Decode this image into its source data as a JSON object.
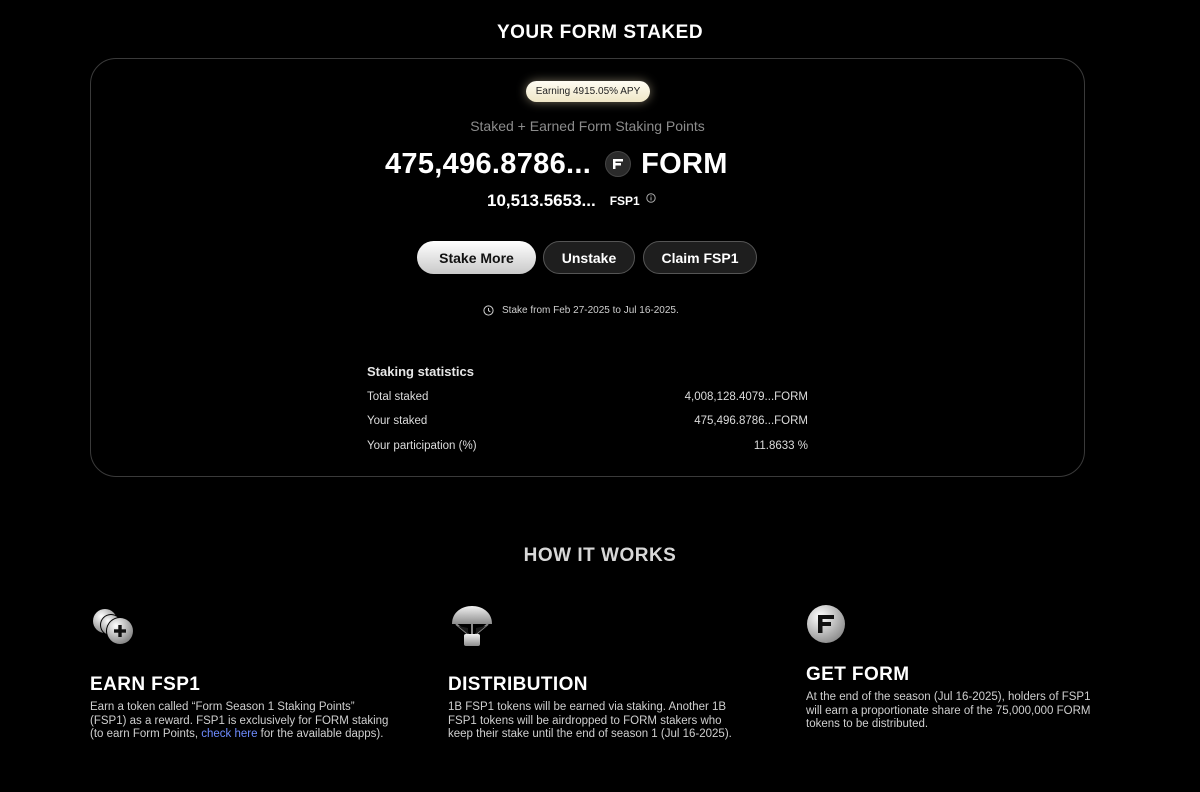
{
  "staked_section": {
    "title": "YOUR FORM STAKED",
    "apy_badge": "Earning 4915.05% APY",
    "subtitle": "Staked + Earned Form Staking Points",
    "form_amount": "475,496.8786...",
    "form_token": "FORM",
    "fsp_amount": "10,513.5653...",
    "fsp_token": "FSP1",
    "buttons": {
      "stake_more": "Stake More",
      "unstake": "Unstake",
      "claim": "Claim FSP1"
    },
    "period": "Stake from Feb 27-2025 to Jul 16-2025."
  },
  "statistics": {
    "title": "Staking statistics",
    "rows": [
      {
        "label": "Total staked",
        "value": "4,008,128.4079...FORM"
      },
      {
        "label": "Your staked",
        "value": "475,496.8786...FORM"
      },
      {
        "label": "Your participation (%)",
        "value": "11.8633 %"
      }
    ]
  },
  "how_it_works": {
    "title": "HOW IT WORKS",
    "items": [
      {
        "icon": "coins-plus-icon",
        "heading": "EARN FSP1",
        "text_before_link": "Earn a token called “Form Season 1 Staking Points” (FSP1) as a reward. FSP1 is exclusively for FORM staking (to earn Form Points, ",
        "link": "check here",
        "text_after_link": " for the available dapps)."
      },
      {
        "icon": "parachute-icon",
        "heading": "DISTRIBUTION",
        "text": "1B FSP1 tokens will be earned via staking. Another 1B FSP1 tokens will be airdropped to FORM stakers who keep their stake until the end of season 1 (Jul 16-2025)."
      },
      {
        "icon": "form-logo-icon",
        "heading": "GET FORM",
        "text": "At the end of the season (Jul 16-2025), holders of FSP1 will earn a proportionate share of the 75,000,000 FORM tokens to be distributed."
      }
    ]
  },
  "colors": {
    "background": "#000000",
    "link": "#6e8cff",
    "apy_badge": "#f6efd6"
  }
}
